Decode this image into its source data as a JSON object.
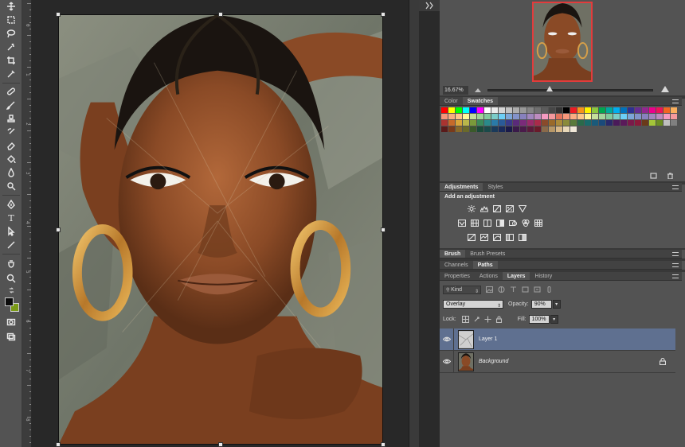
{
  "colors": {
    "toolbar_bg": "#535353",
    "canvas_bg": "#282828",
    "panel_bg": "#535353",
    "selected_layer": "#5f7090",
    "foreground_color": "#0c0c0c",
    "background_color": "#7a9a16",
    "navigator_frame": "#e23c3c"
  },
  "toolbar": {
    "tools": [
      {
        "icon": "move-icon"
      },
      {
        "icon": "marquee-icon"
      },
      {
        "icon": "lasso-icon"
      },
      {
        "icon": "quick-select-icon"
      },
      {
        "icon": "crop-icon"
      },
      {
        "icon": "eyedropper-icon"
      },
      {
        "icon": "healing-icon"
      },
      {
        "icon": "brush-icon"
      },
      {
        "icon": "clone-stamp-icon"
      },
      {
        "icon": "history-brush-icon"
      },
      {
        "icon": "eraser-icon"
      },
      {
        "icon": "bucket-icon"
      },
      {
        "icon": "blur-icon"
      },
      {
        "icon": "dodge-icon"
      },
      {
        "icon": "pen-icon"
      },
      {
        "icon": "type-icon",
        "glyph": "T"
      },
      {
        "icon": "path-select-icon"
      },
      {
        "icon": "line-icon"
      },
      {
        "icon": "hand-icon"
      },
      {
        "icon": "zoom-icon"
      }
    ]
  },
  "ruler": {
    "labels": [
      "0",
      "1",
      "2",
      "3",
      "4",
      "5",
      "6",
      "7",
      "8"
    ]
  },
  "navigator": {
    "zoom": "16.67%"
  },
  "swatches_panel": {
    "tabs": [
      {
        "label": "Color",
        "active": false
      },
      {
        "label": "Swatches",
        "active": true
      }
    ],
    "colors": [
      "#ff0000",
      "#ffff00",
      "#00ff00",
      "#00ffff",
      "#0000ff",
      "#ff00ff",
      "#ffffff",
      "#ebebeb",
      "#d6d6d6",
      "#c2c2c2",
      "#adadad",
      "#999999",
      "#858585",
      "#707070",
      "#5c5c5c",
      "#474747",
      "#333333",
      "#000000",
      "#ed1c24",
      "#f7941d",
      "#fff200",
      "#8dc63f",
      "#00a651",
      "#00a99d",
      "#00aeef",
      "#0072bc",
      "#2e3192",
      "#662d91",
      "#92278f",
      "#ec008c",
      "#ed145b",
      "#f26522",
      "#fbaf5d",
      "#f69679",
      "#f9ad81",
      "#fdc689",
      "#fff799",
      "#c4df9b",
      "#a3d39c",
      "#82ca9d",
      "#7accc8",
      "#6dcff6",
      "#7da7d9",
      "#8393ca",
      "#8781bd",
      "#a186be",
      "#bd8cbf",
      "#f49ac1",
      "#f5989d",
      "#e2725b",
      "#f7977a",
      "#fbad82",
      "#fdc68a",
      "#fff79a",
      "#c6df9c",
      "#a4d49d",
      "#81ca9d",
      "#7bcdc8",
      "#6ccff7",
      "#7ca6d8",
      "#8293ca",
      "#8881be",
      "#a286bd",
      "#bc8cbf",
      "#f49bc1",
      "#f5999d",
      "#aa3330",
      "#c66a2a",
      "#d8a53a",
      "#b9b64a",
      "#7a9a3a",
      "#3a8a5a",
      "#2a8a8a",
      "#2a7aa8",
      "#2a5a98",
      "#3a3a8a",
      "#5a2a7a",
      "#7a2a7a",
      "#9a2a6a",
      "#aa2a4a",
      "#8a4a2a",
      "#9a6a2a",
      "#aa8a3a",
      "#8a8a3a",
      "#5a7a3a",
      "#2a6a4a",
      "#1a6a6a",
      "#1a5a7a",
      "#1a4a7a",
      "#2a2a6a",
      "#4a1a5a",
      "#5a1a5a",
      "#7a1a4a",
      "#8a1a3a",
      "#6a3a1a",
      "#a4c639",
      "#6b8e23",
      "#c0c0c0",
      "#808080",
      "#5a1a1a",
      "#7a3a1a",
      "#8a6a2a",
      "#6a6a2a",
      "#3a5a2a",
      "#1a4a3a",
      "#1a4a4a",
      "#1a3a5a",
      "#1a2a5a",
      "#1a1a4a",
      "#3a1a4a",
      "#4a1a4a",
      "#5a1a3a",
      "#6a1a2a",
      "#8a6a4a",
      "#b89868",
      "#d8b888",
      "#e8d8b8",
      "#f0e8d8"
    ]
  },
  "adjustments_panel": {
    "tabs": [
      {
        "label": "Adjustments",
        "active": true
      },
      {
        "label": "Styles",
        "active": false
      }
    ],
    "title": "Add an adjustment",
    "row1": [
      "brightness-icon",
      "levels-icon",
      "curves-icon",
      "exposure-icon",
      "gradient-triangle-icon"
    ],
    "row2": [
      "vibrance-icon",
      "hue-icon",
      "color-balance-icon",
      "bw-icon",
      "photo-filter-icon",
      "channel-mixer-icon",
      "color-lookup-icon"
    ],
    "row3": [
      "invert-icon",
      "posterize-icon",
      "threshold-icon",
      "gradient-map-icon",
      "selective-color-icon"
    ]
  },
  "brush_panel": {
    "tabs": [
      {
        "label": "Brush",
        "active": true
      },
      {
        "label": "Brush Presets",
        "active": false
      }
    ]
  },
  "channels_panel": {
    "tabs": [
      {
        "label": "Channels",
        "active": false
      },
      {
        "label": "Paths",
        "active": true
      }
    ]
  },
  "layers_panel": {
    "tabs": [
      {
        "label": "Properties",
        "active": false
      },
      {
        "label": "Actions",
        "active": false
      },
      {
        "label": "Layers",
        "active": true
      },
      {
        "label": "History",
        "active": false
      }
    ],
    "kind_label": "Kind",
    "blend_mode": "Overlay",
    "opacity_label": "Opacity:",
    "opacity_value": "90%",
    "lock_label": "Lock:",
    "fill_label": "Fill:",
    "fill_value": "100%",
    "layers": [
      {
        "name": "Layer 1",
        "selected": true,
        "italic": false,
        "locked": false
      },
      {
        "name": "Background",
        "selected": false,
        "italic": true,
        "locked": true
      }
    ]
  }
}
